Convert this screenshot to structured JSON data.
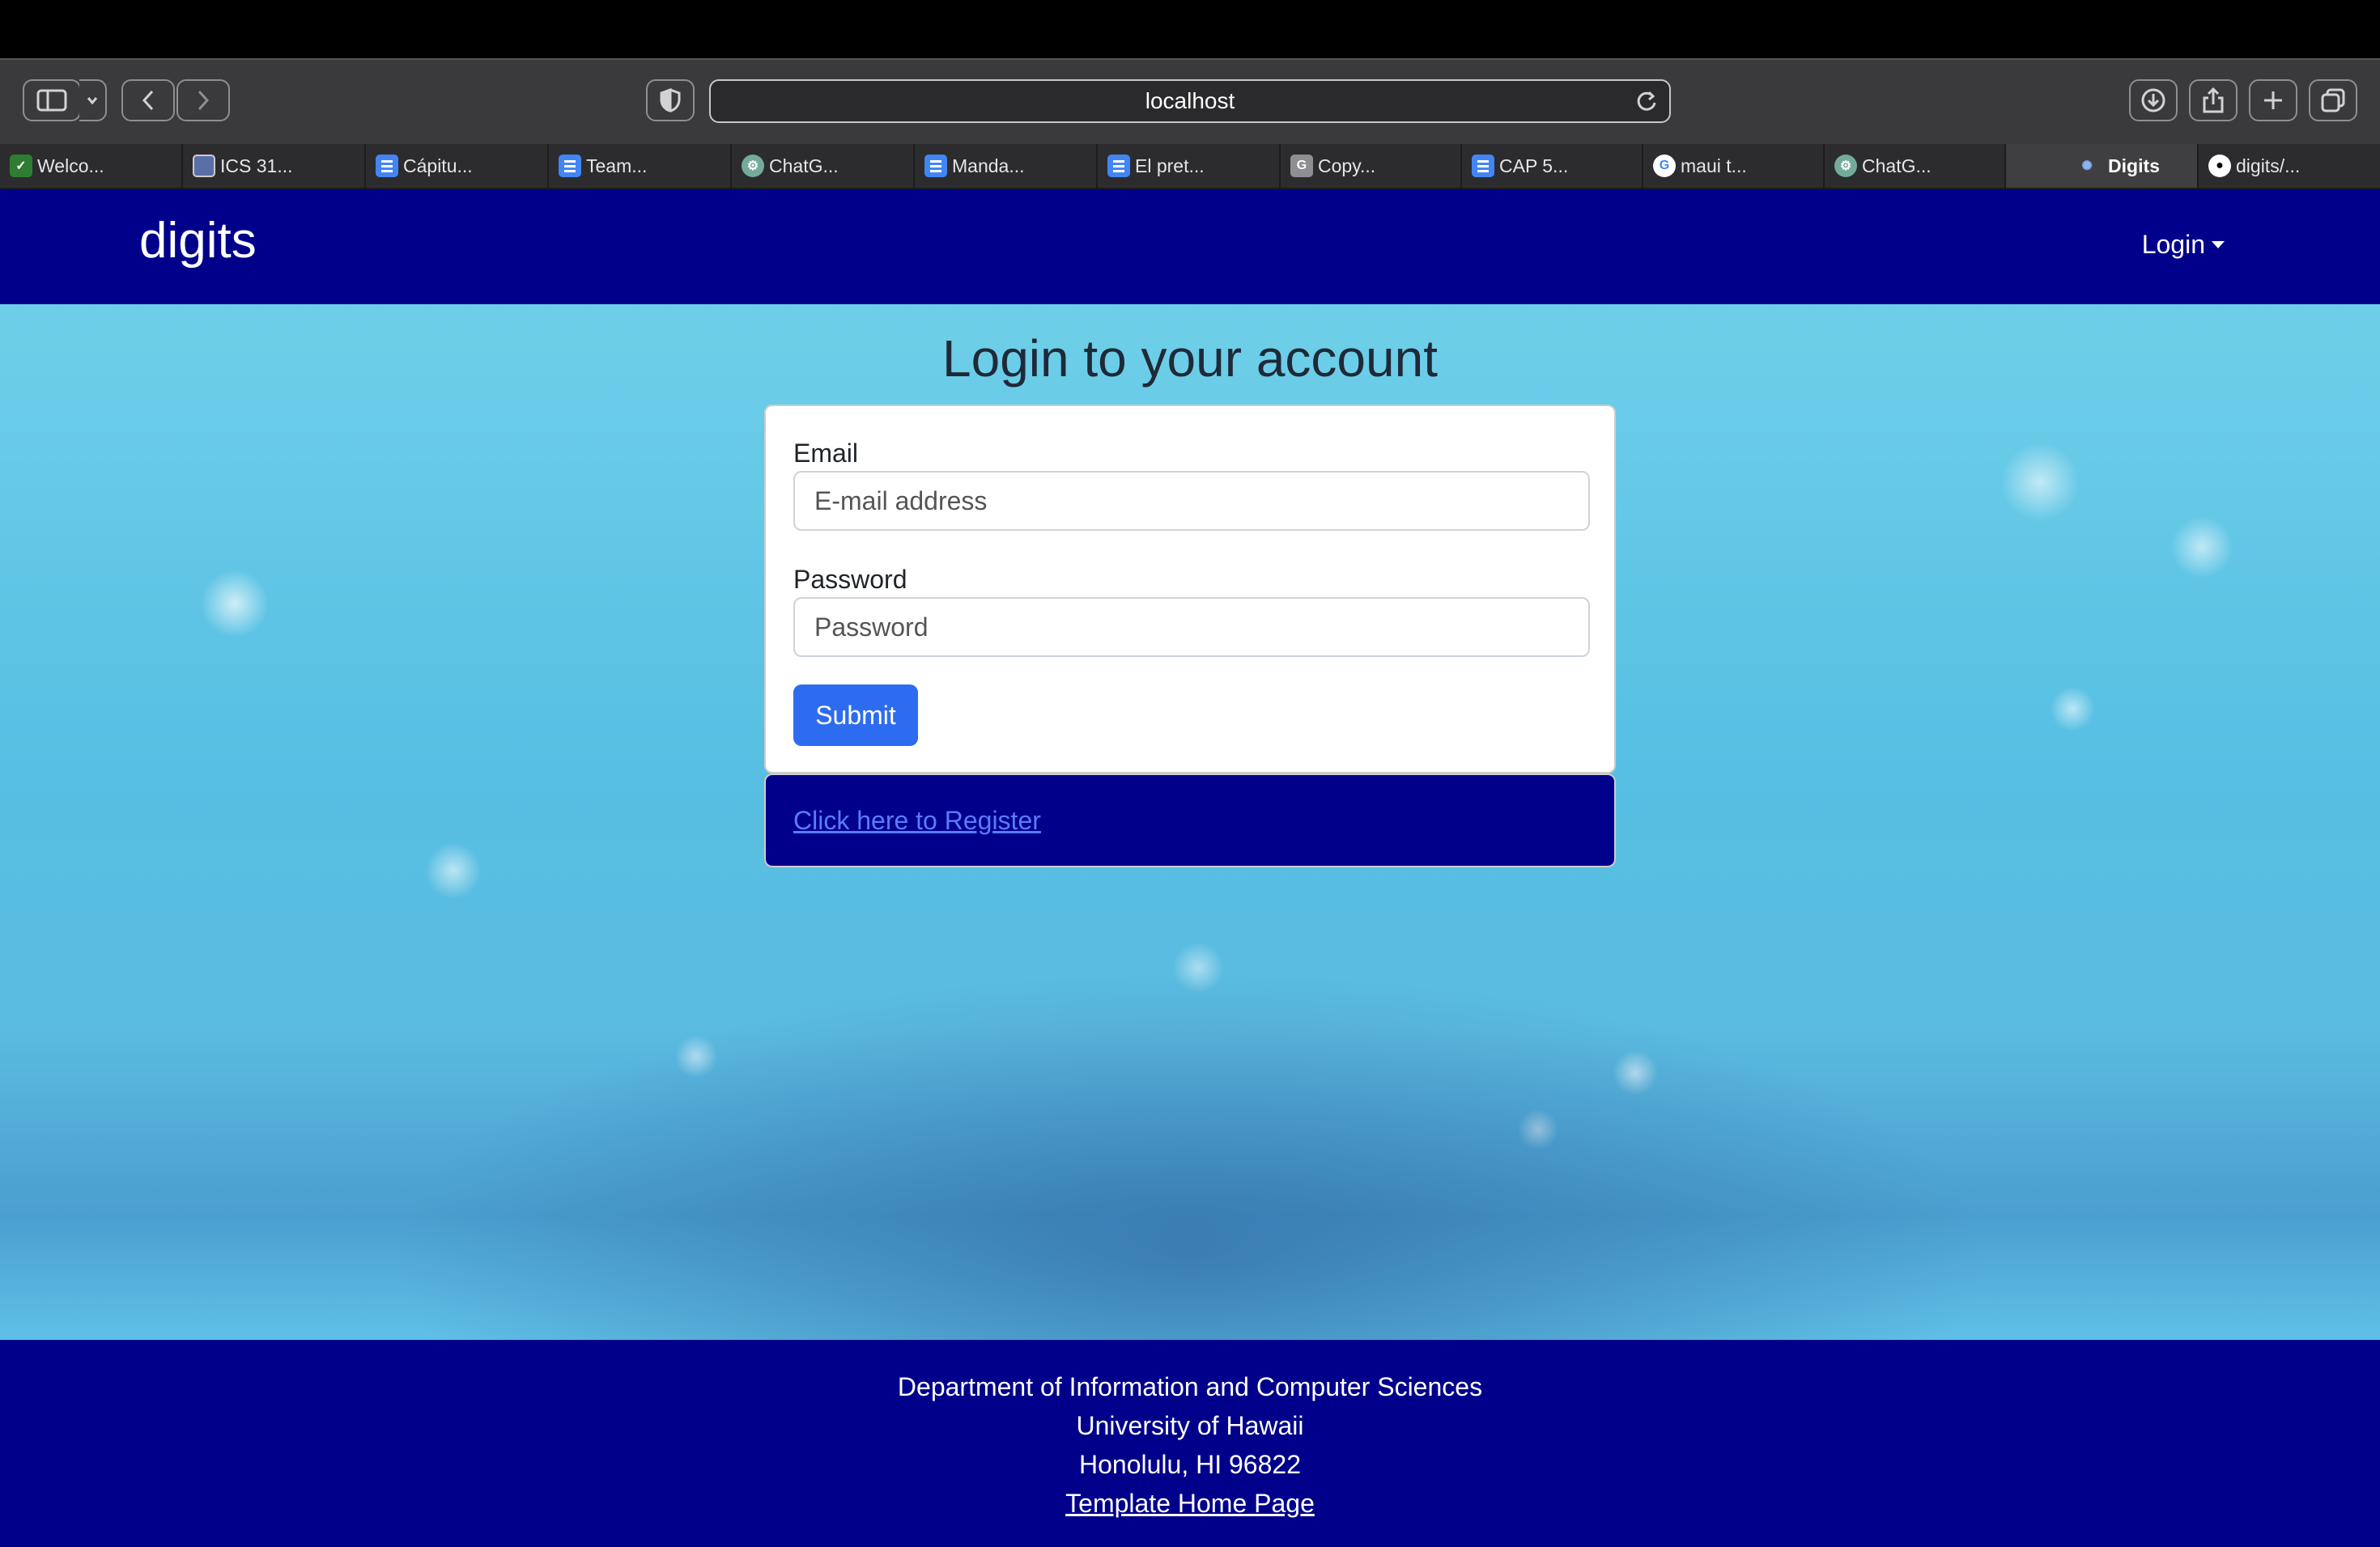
{
  "browser": {
    "url": "localhost",
    "tabs": [
      {
        "label": "Welco...",
        "icon": "leaf-favicon-icon"
      },
      {
        "label": "ICS 31...",
        "icon": "square-favicon-icon"
      },
      {
        "label": "Cápitu...",
        "icon": "docs-favicon-icon"
      },
      {
        "label": "Team...",
        "icon": "docs-favicon-icon"
      },
      {
        "label": "ChatG...",
        "icon": "chatgpt-favicon-icon"
      },
      {
        "label": "Manda...",
        "icon": "docs-favicon-icon"
      },
      {
        "label": "El pret...",
        "icon": "docs-favicon-icon"
      },
      {
        "label": "Copy...",
        "icon": "g-favicon-icon"
      },
      {
        "label": "CAP 5...",
        "icon": "docs-favicon-icon"
      },
      {
        "label": "maui t...",
        "icon": "google-favicon-icon"
      },
      {
        "label": "ChatG...",
        "icon": "chatgpt-favicon-icon"
      },
      {
        "label": "Digits",
        "icon": "digits-favicon-icon",
        "active": true
      },
      {
        "label": "digits/...",
        "icon": "github-favicon-icon"
      }
    ]
  },
  "navbar": {
    "brand": "digits",
    "login_label": "Login"
  },
  "login": {
    "title": "Login to your account",
    "email_label": "Email",
    "email_placeholder": "E-mail address",
    "password_label": "Password",
    "password_placeholder": "Password",
    "submit_label": "Submit",
    "register_link": "Click here to Register"
  },
  "footer": {
    "line1": "Department of Information and Computer Sciences",
    "line2": "University of Hawaii",
    "line3": "Honolulu, HI 96822",
    "link": "Template Home Page"
  },
  "colors": {
    "navbar": "#00008b",
    "submit": "#2d6cf0",
    "register_link": "#5a7bff"
  }
}
